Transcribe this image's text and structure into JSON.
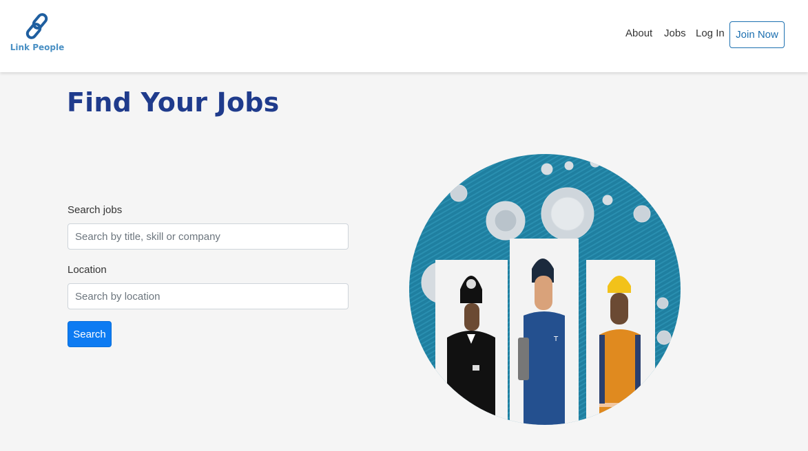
{
  "brand": {
    "name": "Link People",
    "icon": "chain-link-icon",
    "color": "#4a90c4"
  },
  "nav": {
    "items": [
      {
        "label": "About"
      },
      {
        "label": "Jobs"
      },
      {
        "label": "Log In"
      }
    ],
    "join_label": "Join Now",
    "accent": "#1b6fb0"
  },
  "main": {
    "title": "Find Your Jobs",
    "title_color": "#1f3b8c",
    "search": {
      "label": "Search jobs",
      "placeholder": "Search by title, skill or company",
      "value": ""
    },
    "location": {
      "label": "Location",
      "placeholder": "Search by location",
      "value": ""
    },
    "search_button": "Search",
    "button_color": "#0d7bf2"
  },
  "hero": {
    "image": "workers-illustration",
    "subjects": [
      "police-officer",
      "nurse",
      "construction-worker"
    ]
  }
}
